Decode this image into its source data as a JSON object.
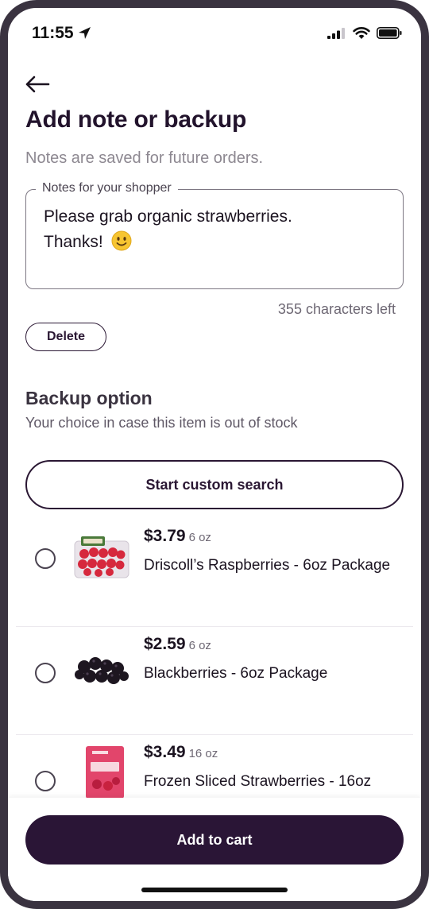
{
  "status_bar": {
    "time": "11:55"
  },
  "header": {
    "title": "Add note or backup",
    "subtitle": "Notes are saved for future orders."
  },
  "notes": {
    "label": "Notes for your shopper",
    "value_line1": "Please grab organic strawberries.",
    "value_line2": "Thanks!",
    "emoji": "slightly-smiling-face",
    "chars_left": "355 characters left",
    "delete_label": "Delete"
  },
  "backup": {
    "title": "Backup option",
    "subtitle": "Your choice in case this item is out of stock",
    "search_label": "Start custom search",
    "items": [
      {
        "price": "$3.79",
        "size": "6 oz",
        "name": "Driscoll’s Raspberries - 6oz Package",
        "icon": "raspberries-thumbnail"
      },
      {
        "price": "$2.59",
        "size": "6 oz",
        "name": "Blackberries - 6oz Package",
        "icon": "blackberries-thumbnail"
      },
      {
        "price": "$3.49",
        "size": "16 oz",
        "name": "Frozen Sliced Strawberries - 16oz",
        "icon": "frozen-strawberries-thumbnail"
      }
    ]
  },
  "footer": {
    "cart_label": "Add to cart"
  },
  "colors": {
    "brand_dark": "#2a1536",
    "text_primary": "#1b1320",
    "text_muted": "#8d8891"
  }
}
